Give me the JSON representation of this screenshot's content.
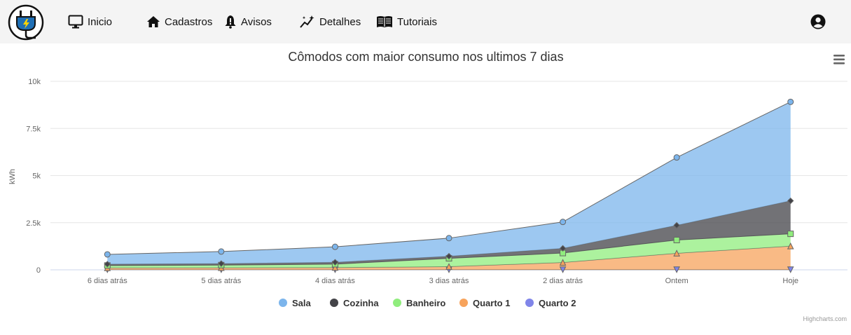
{
  "nav": {
    "items": [
      {
        "label": "Inicio",
        "icon": "monitor-icon"
      },
      {
        "label": "Cadastros",
        "icon": "home-icon"
      },
      {
        "label": "Avisos",
        "icon": "bell-alert-icon"
      },
      {
        "label": "Detalhes",
        "icon": "sparkle-chart-icon"
      },
      {
        "label": "Tutoriais",
        "icon": "book-icon"
      }
    ],
    "user_icon": "user-circle-icon",
    "logo_icon": "electric-plug-icon"
  },
  "chart_data": {
    "type": "area",
    "stacked": true,
    "title": "Cômodos com maior consumo nos ultimos 7 dias",
    "ylabel": "kWh",
    "xlabel": "",
    "ylim": [
      0,
      10000
    ],
    "yticks": [
      "0",
      "2.5k",
      "5k",
      "7.5k",
      "10k"
    ],
    "ytick_values": [
      0,
      2500,
      5000,
      7500,
      10000
    ],
    "categories": [
      "6 dias atrás",
      "5 dias atrás",
      "4 dias atrás",
      "3 dias atrás",
      "2 dias atrás",
      "Ontem",
      "Hoje"
    ],
    "grid": true,
    "legend_position": "bottom-center",
    "credits": "Highcharts.com",
    "series": [
      {
        "name": "Sala",
        "color": "#7cb5ec",
        "marker": "circle",
        "values": [
          520,
          640,
          820,
          960,
          1400,
          3600,
          5250
        ]
      },
      {
        "name": "Cozinha",
        "color": "#434348",
        "marker": "diamond",
        "values": [
          70,
          80,
          100,
          110,
          250,
          780,
          1750
        ]
      },
      {
        "name": "Banheiro",
        "color": "#90ed7d",
        "marker": "square",
        "values": [
          130,
          140,
          180,
          440,
          500,
          700,
          650
        ]
      },
      {
        "name": "Quarto 1",
        "color": "#f7a35c",
        "marker": "triangle",
        "values": [
          90,
          100,
          110,
          160,
          380,
          870,
          1250
        ]
      },
      {
        "name": "Quarto 2",
        "color": "#8085e9",
        "marker": "triangle-down",
        "values": [
          10,
          10,
          10,
          10,
          10,
          10,
          10
        ]
      }
    ]
  }
}
